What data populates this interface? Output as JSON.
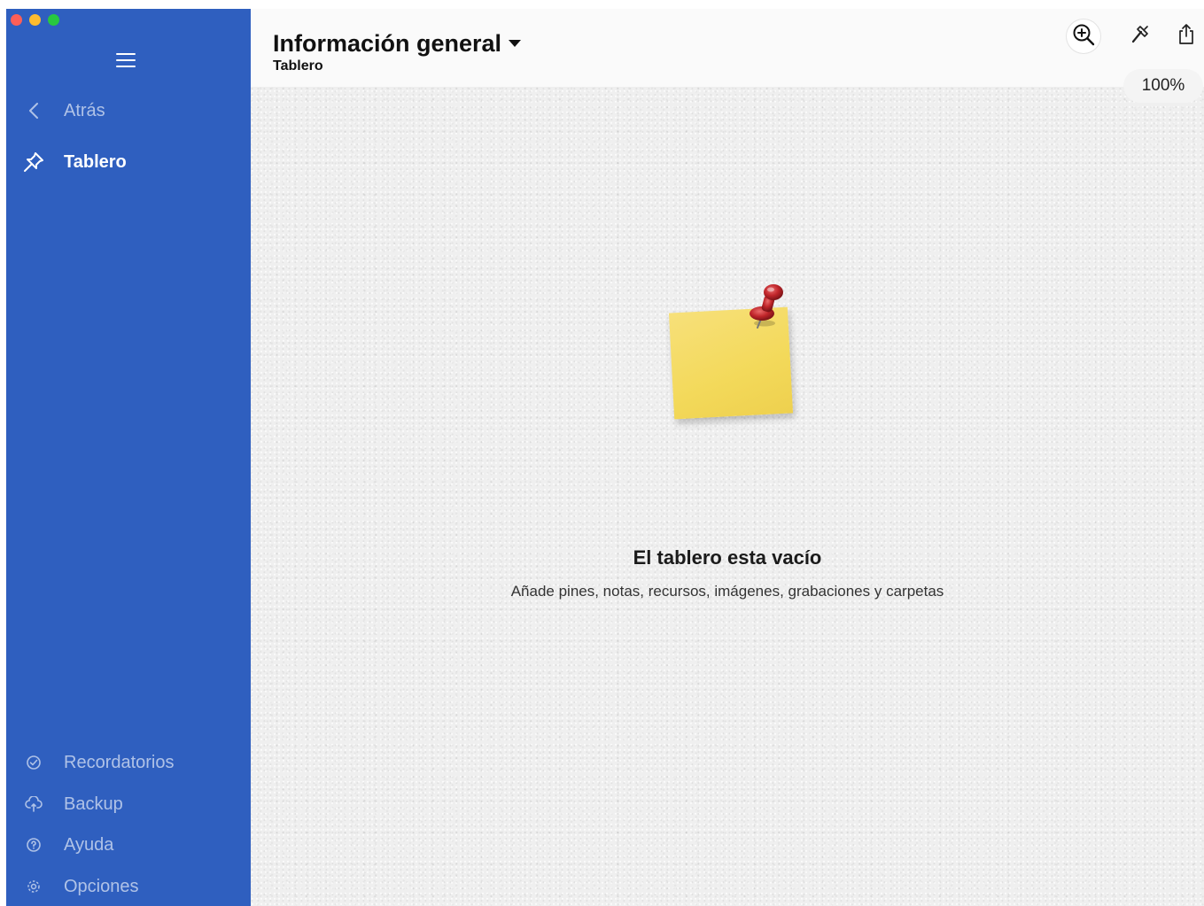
{
  "window": {
    "traffic_lights": [
      "#fe5f57",
      "#febc2e",
      "#28c840"
    ]
  },
  "sidebar": {
    "menu_icon": "hamburger-icon",
    "back": {
      "label": "Atrás",
      "icon": "chevron-left-icon"
    },
    "items": [
      {
        "label": "Tablero",
        "icon": "pin-icon",
        "active": true
      }
    ],
    "bottom_items": [
      {
        "label": "Recordatorios",
        "icon": "check-circle-icon"
      },
      {
        "label": "Backup",
        "icon": "cloud-sync-icon"
      },
      {
        "label": "Ayuda",
        "icon": "help-circle-icon"
      },
      {
        "label": "Opciones",
        "icon": "gear-icon"
      }
    ],
    "bg_color": "#2f5fbf"
  },
  "header": {
    "title": "Información general",
    "subtitle": "Tablero",
    "tools": [
      "zoom-in-icon",
      "hammer-icon",
      "share-icon"
    ],
    "zoom_level": "100%"
  },
  "board": {
    "empty_title": "El tablero esta vacío",
    "empty_subtitle": "Añade pines, notas, recursos, imágenes, grabaciones y carpetas"
  }
}
